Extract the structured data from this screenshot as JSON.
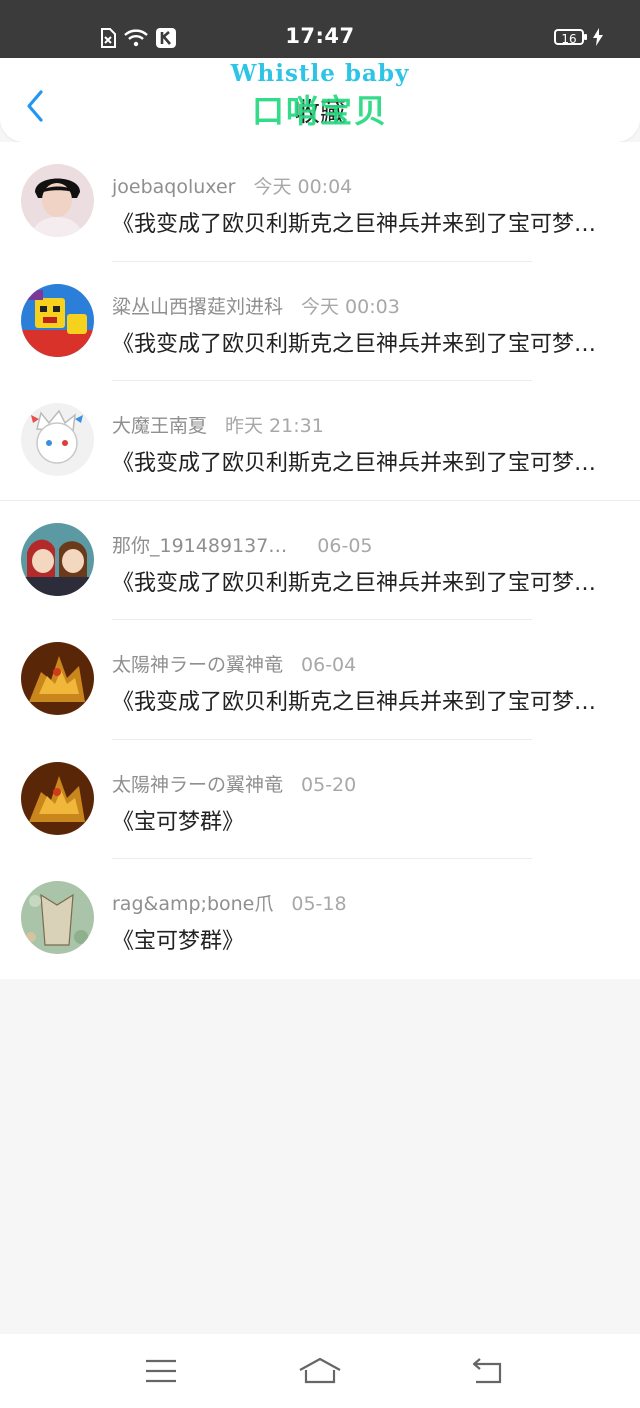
{
  "status_bar": {
    "time": "17:47",
    "battery": "16"
  },
  "header": {
    "title": "收藏",
    "logo_en": "Whistle baby",
    "logo_cn": "口哨宝贝"
  },
  "items": [
    {
      "name": "joebaqoluxer",
      "time": "今天 00:04",
      "message": "《我变成了欧贝利斯克之巨神兵并来到了宝可梦世界》"
    },
    {
      "name": "粱丛山西撂莚刘进科",
      "time": "今天 00:03",
      "message": "《我变成了欧贝利斯克之巨神兵并来到了宝可梦世界》"
    },
    {
      "name": "大魔王南夏",
      "time": "昨天 21:31",
      "message": "《我变成了欧贝利斯克之巨神兵并来到了宝可梦世界》"
    },
    {
      "name": "那你_191489137…",
      "time": "06-05",
      "message": "《我变成了欧贝利斯克之巨神兵并来到了宝可梦世界》"
    },
    {
      "name": "太陽神ラーの翼神竜",
      "time": "06-04",
      "message": "《我变成了欧贝利斯克之巨神兵并来到了宝可梦世界》"
    },
    {
      "name": "太陽神ラーの翼神竜",
      "time": "05-20",
      "message": "《宝可梦群》"
    },
    {
      "name": "rag&amp;bone爪",
      "time": "05-18",
      "message": "《宝可梦群》"
    }
  ],
  "colors": {
    "accent": "#2196f3",
    "logo_en": "#2ec4e6",
    "logo_cn": "#23d97e"
  }
}
